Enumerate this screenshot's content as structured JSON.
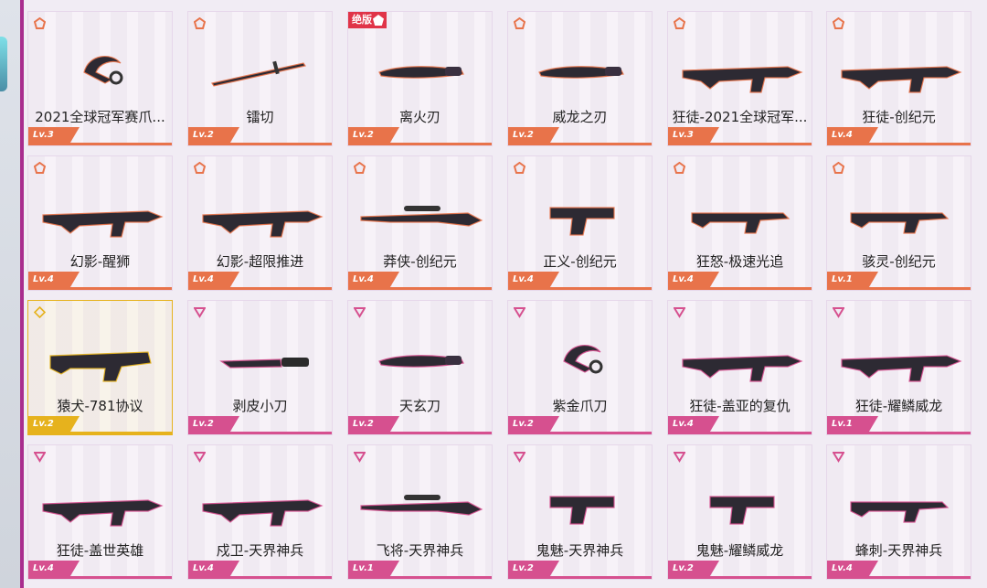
{
  "colors": {
    "tier_orange": "#e8734a",
    "tier_pink": "#d6508f",
    "tier_gold": "#e6b21d",
    "exclusive_red": "#e03448"
  },
  "badge_exclusive": "绝版",
  "cards": [
    {
      "name": "2021全球冠军赛爪...",
      "level": "Lv.3",
      "tier": "orange",
      "weapon": "knife-karambit-icon",
      "exclusive": false
    },
    {
      "name": "镭切",
      "level": "Lv.2",
      "tier": "orange",
      "weapon": "katana-icon",
      "exclusive": false
    },
    {
      "name": "离火刃",
      "level": "Lv.2",
      "tier": "orange",
      "weapon": "blade-icon",
      "exclusive": true
    },
    {
      "name": "威龙之刃",
      "level": "Lv.2",
      "tier": "orange",
      "weapon": "dagger-icon",
      "exclusive": false
    },
    {
      "name": "狂徒-2021全球冠军...",
      "level": "Lv.3",
      "tier": "orange",
      "weapon": "rifle-icon",
      "exclusive": false
    },
    {
      "name": "狂徒-创纪元",
      "level": "Lv.4",
      "tier": "orange",
      "weapon": "rifle-icon",
      "exclusive": false
    },
    {
      "name": "幻影-醒狮",
      "level": "Lv.4",
      "tier": "orange",
      "weapon": "rifle-icon",
      "exclusive": false
    },
    {
      "name": "幻影-超限推进",
      "level": "Lv.4",
      "tier": "orange",
      "weapon": "rifle-icon",
      "exclusive": false
    },
    {
      "name": "莽侠-创纪元",
      "level": "Lv.4",
      "tier": "orange",
      "weapon": "sniper-icon",
      "exclusive": false
    },
    {
      "name": "正义-创纪元",
      "level": "Lv.4",
      "tier": "orange",
      "weapon": "pistol-icon",
      "exclusive": false
    },
    {
      "name": "狂怒-极速光追",
      "level": "Lv.4",
      "tier": "orange",
      "weapon": "smg-icon",
      "exclusive": false
    },
    {
      "name": "骇灵-创纪元",
      "level": "Lv.1",
      "tier": "orange",
      "weapon": "smg-icon",
      "exclusive": false
    },
    {
      "name": "猿犬-781协议",
      "level": "Lv.2",
      "tier": "gold",
      "weapon": "bulldog-icon",
      "exclusive": false
    },
    {
      "name": "剥皮小刀",
      "level": "Lv.2",
      "tier": "pink",
      "weapon": "knife-icon",
      "exclusive": false
    },
    {
      "name": "天玄刀",
      "level": "Lv.2",
      "tier": "pink",
      "weapon": "curved-blade-icon",
      "exclusive": false
    },
    {
      "name": "紫金爪刀",
      "level": "Lv.2",
      "tier": "pink",
      "weapon": "knife-karambit-icon",
      "exclusive": false
    },
    {
      "name": "狂徒-盖亚的复仇",
      "level": "Lv.4",
      "tier": "pink",
      "weapon": "rifle-icon",
      "exclusive": false
    },
    {
      "name": "狂徒-耀鳞威龙",
      "level": "Lv.1",
      "tier": "pink",
      "weapon": "rifle-icon",
      "exclusive": false
    },
    {
      "name": "狂徒-盖世英雄",
      "level": "Lv.4",
      "tier": "pink",
      "weapon": "rifle-icon",
      "exclusive": false
    },
    {
      "name": "戍卫-天界神兵",
      "level": "Lv.4",
      "tier": "pink",
      "weapon": "rifle-icon",
      "exclusive": false
    },
    {
      "name": "飞将-天界神兵",
      "level": "Lv.1",
      "tier": "pink",
      "weapon": "sniper-icon",
      "exclusive": false
    },
    {
      "name": "鬼魅-天界神兵",
      "level": "Lv.2",
      "tier": "pink",
      "weapon": "pistol-icon",
      "exclusive": false
    },
    {
      "name": "鬼魅-耀鳞威龙",
      "level": "Lv.2",
      "tier": "pink",
      "weapon": "pistol-icon",
      "exclusive": false
    },
    {
      "name": "蜂刺-天界神兵",
      "level": "Lv.4",
      "tier": "pink",
      "weapon": "smg-icon",
      "exclusive": false
    }
  ]
}
